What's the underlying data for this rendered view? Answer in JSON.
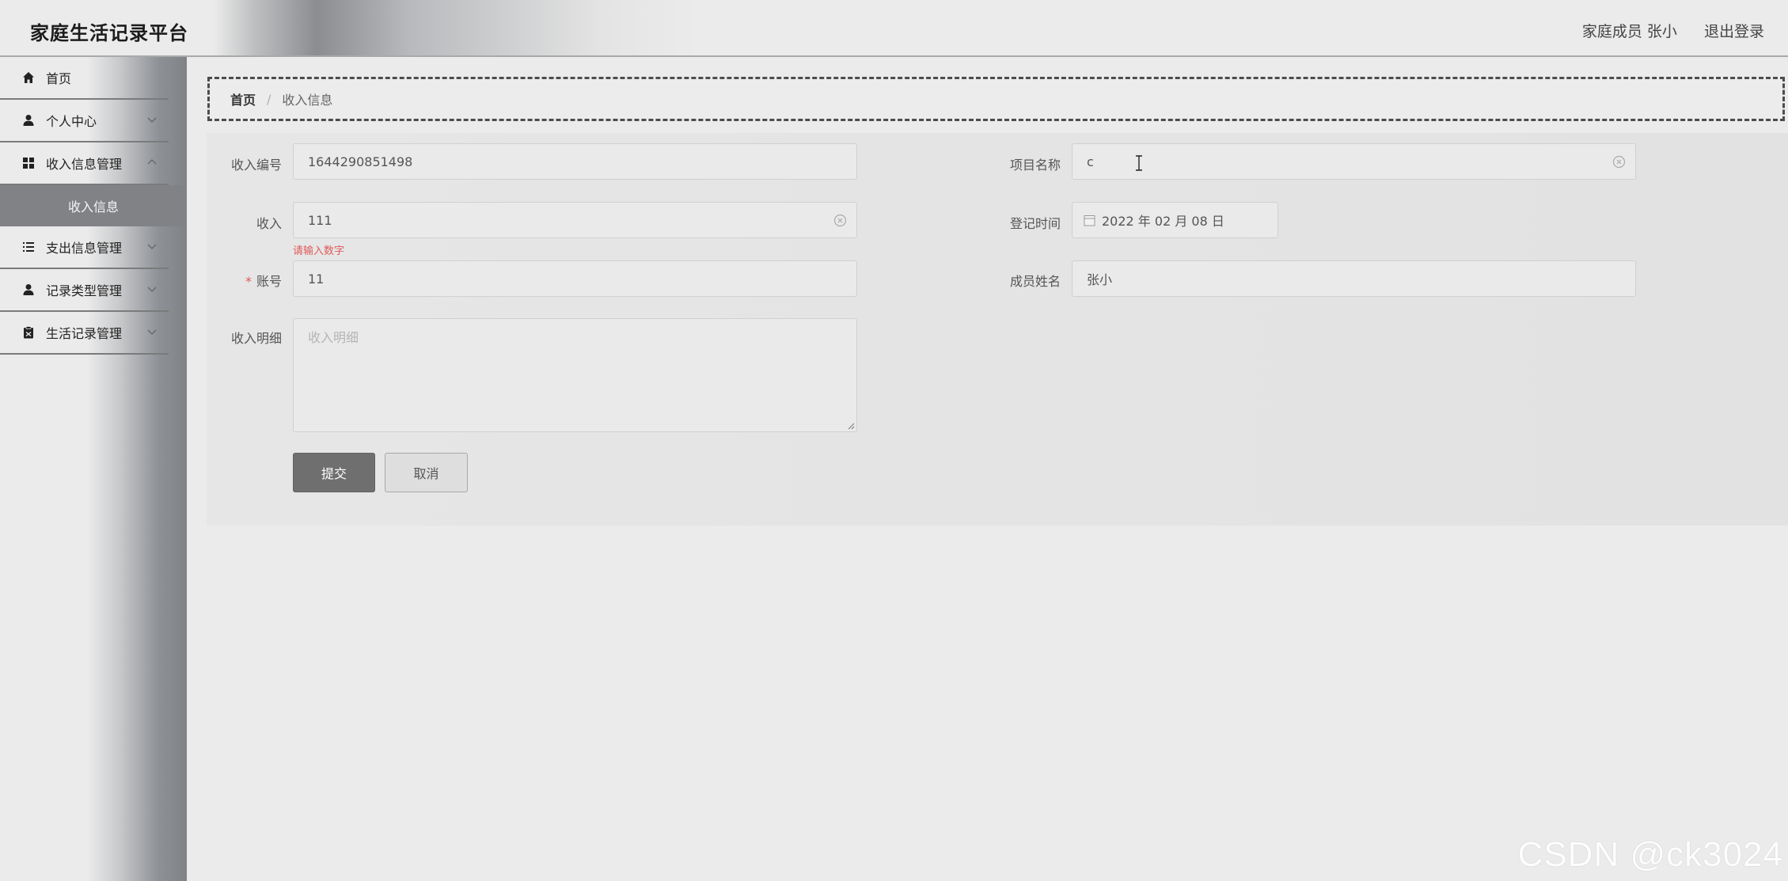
{
  "header": {
    "title": "家庭生活记录平台",
    "member": "家庭成员 张小",
    "logout": "退出登录"
  },
  "sidebar": {
    "items": [
      {
        "label": "首页",
        "icon": "home-icon"
      },
      {
        "label": "个人中心",
        "icon": "user-icon"
      },
      {
        "label": "收入信息管理",
        "icon": "grid-icon"
      },
      {
        "label": "收入信息",
        "submenu": true
      },
      {
        "label": "支出信息管理",
        "icon": "list-icon"
      },
      {
        "label": "记录类型管理",
        "icon": "user-icon"
      },
      {
        "label": "生活记录管理",
        "icon": "clipboard-icon"
      }
    ]
  },
  "breadcrumb": {
    "home": "首页",
    "separator": "/",
    "current": "收入信息"
  },
  "form": {
    "income_no": {
      "label": "收入编号",
      "value": "1644290851498"
    },
    "project_name": {
      "label": "项目名称",
      "value": "c"
    },
    "income": {
      "label": "收入",
      "value": "111",
      "error": "请输入数字"
    },
    "register_time": {
      "label": "登记时间",
      "value": "2022 年 02 月 08 日"
    },
    "account": {
      "label": "账号",
      "required_mark": "*",
      "value": "11"
    },
    "member_name": {
      "label": "成员姓名",
      "value": "张小"
    },
    "income_detail": {
      "label": "收入明细",
      "placeholder": "收入明细"
    },
    "submit_label": "提交",
    "cancel_label": "取消"
  },
  "watermark": "CSDN @ck3024",
  "colors": {
    "submit_bg": "#6f6f6f",
    "error": "#e05a5a",
    "submenu_bg": "#808286"
  }
}
